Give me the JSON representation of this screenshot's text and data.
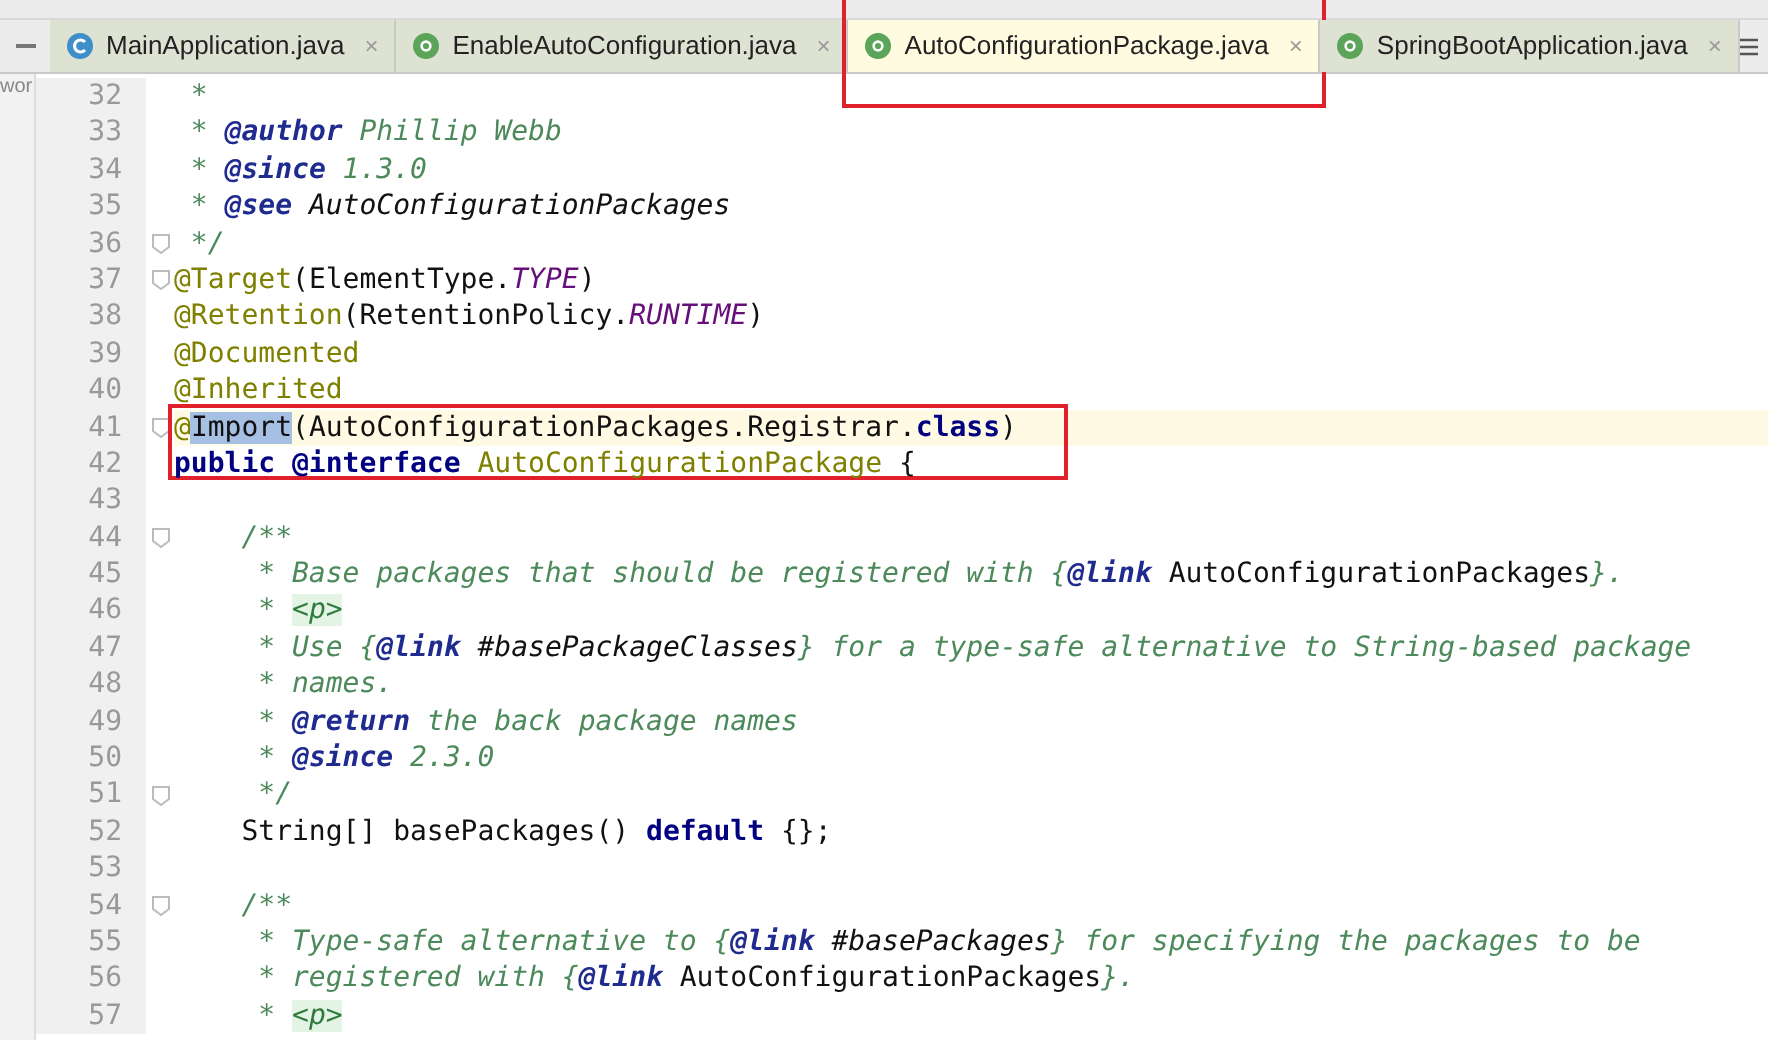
{
  "side_panel": {
    "text": "wor"
  },
  "tabs": [
    {
      "label": "MainApplication.java",
      "kind": "class",
      "close": "×",
      "selected": false,
      "marked": false
    },
    {
      "label": "EnableAutoConfiguration.java",
      "kind": "annotation",
      "close": "×",
      "selected": false,
      "marked": false
    },
    {
      "label": "AutoConfigurationPackage.java",
      "kind": "annotation",
      "close": "×",
      "selected": true,
      "marked": true
    },
    {
      "label": "SpringBootApplication.java",
      "kind": "annotation",
      "close": "×",
      "selected": false,
      "marked": false
    }
  ],
  "lines": [
    {
      "number": "32",
      "tokens": [
        {
          "text": " *",
          "kind": "comment"
        }
      ]
    },
    {
      "number": "33",
      "tokens": [
        {
          "text": " * ",
          "kind": "comment"
        },
        {
          "text": "@author",
          "kind": "doctag"
        },
        {
          "text": " Phillip Webb",
          "kind": "comment"
        }
      ]
    },
    {
      "number": "34",
      "tokens": [
        {
          "text": " * ",
          "kind": "comment"
        },
        {
          "text": "@since",
          "kind": "doctag"
        },
        {
          "text": " 1.3.0",
          "kind": "comment"
        }
      ]
    },
    {
      "number": "35",
      "tokens": [
        {
          "text": " * ",
          "kind": "comment"
        },
        {
          "text": "@see",
          "kind": "doctag"
        },
        {
          "text": " AutoConfigurationPackages",
          "kind": "ref"
        }
      ]
    },
    {
      "number": "36",
      "fold": true,
      "tokens": [
        {
          "text": " */",
          "kind": "comment"
        }
      ]
    },
    {
      "number": "37",
      "fold": true,
      "tokens": [
        {
          "text": "@Target",
          "kind": "annotation"
        },
        {
          "text": "(ElementType.",
          "kind": "plain"
        },
        {
          "text": "TYPE",
          "kind": "constant"
        },
        {
          "text": ")",
          "kind": "plain"
        }
      ]
    },
    {
      "number": "38",
      "tokens": [
        {
          "text": "@Retention",
          "kind": "annotation"
        },
        {
          "text": "(RetentionPolicy.",
          "kind": "plain"
        },
        {
          "text": "RUNTIME",
          "kind": "constant"
        },
        {
          "text": ")",
          "kind": "plain"
        }
      ]
    },
    {
      "number": "39",
      "tokens": [
        {
          "text": "@Documented",
          "kind": "annotation"
        }
      ]
    },
    {
      "number": "40",
      "tokens": [
        {
          "text": "@Inherited",
          "kind": "annotation"
        }
      ]
    },
    {
      "number": "41",
      "fold": true,
      "current": true,
      "marked": true,
      "tokens": [
        {
          "text": "@",
          "kind": "annotation"
        },
        {
          "text": "Import",
          "kind": "selected"
        },
        {
          "text": "(AutoConfigurationPackages.Registrar.",
          "kind": "plain"
        },
        {
          "text": "class",
          "kind": "keyword"
        },
        {
          "text": ")",
          "kind": "plain"
        }
      ]
    },
    {
      "number": "42",
      "tokens": [
        {
          "text": "public @interface",
          "kind": "keyword"
        },
        {
          "text": " AutoConfigurationPackage",
          "kind": "annotation"
        },
        {
          "text": " {",
          "kind": "plain"
        }
      ]
    },
    {
      "number": "43"
    },
    {
      "number": "44",
      "fold": true,
      "tokens": [
        {
          "text": "    /**",
          "kind": "comment"
        }
      ]
    },
    {
      "number": "45",
      "tokens": [
        {
          "text": "     * Base packages that should be registered with {",
          "kind": "comment"
        },
        {
          "text": "@link",
          "kind": "doctag"
        },
        {
          "text": " AutoConfigurationPackages",
          "kind": "plain"
        },
        {
          "text": "}.",
          "kind": "comment"
        }
      ]
    },
    {
      "number": "46",
      "tokens": [
        {
          "text": "     * ",
          "kind": "comment"
        },
        {
          "text": "<p>",
          "kind": "html"
        }
      ]
    },
    {
      "number": "47",
      "tokens": [
        {
          "text": "     * Use {",
          "kind": "comment"
        },
        {
          "text": "@link",
          "kind": "doctag"
        },
        {
          "text": " #basePackageClasses",
          "kind": "ref"
        },
        {
          "text": "} for a type-safe alternative to String-based package",
          "kind": "comment"
        }
      ]
    },
    {
      "number": "48",
      "tokens": [
        {
          "text": "     * names.",
          "kind": "comment"
        }
      ]
    },
    {
      "number": "49",
      "tokens": [
        {
          "text": "     * ",
          "kind": "comment"
        },
        {
          "text": "@return",
          "kind": "doctag"
        },
        {
          "text": " the back package names",
          "kind": "comment"
        }
      ]
    },
    {
      "number": "50",
      "tokens": [
        {
          "text": "     * ",
          "kind": "comment"
        },
        {
          "text": "@since",
          "kind": "doctag"
        },
        {
          "text": " 2.3.0",
          "kind": "comment"
        }
      ]
    },
    {
      "number": "51",
      "fold": true,
      "tokens": [
        {
          "text": "     */",
          "kind": "comment"
        }
      ]
    },
    {
      "number": "52",
      "tokens": [
        {
          "text": "    String[] basePackages() ",
          "kind": "plain"
        },
        {
          "text": "default",
          "kind": "keyword"
        },
        {
          "text": " {};",
          "kind": "plain"
        }
      ]
    },
    {
      "number": "53"
    },
    {
      "number": "54",
      "fold": true,
      "tokens": [
        {
          "text": "    /**",
          "kind": "comment"
        }
      ]
    },
    {
      "number": "55",
      "tokens": [
        {
          "text": "     * Type-safe alternative to {",
          "kind": "comment"
        },
        {
          "text": "@link",
          "kind": "doctag"
        },
        {
          "text": " #basePackages",
          "kind": "ref"
        },
        {
          "text": "} for specifying the packages to be",
          "kind": "comment"
        }
      ]
    },
    {
      "number": "56",
      "tokens": [
        {
          "text": "     * registered with {",
          "kind": "comment"
        },
        {
          "text": "@link",
          "kind": "doctag"
        },
        {
          "text": " AutoConfigurationPackages",
          "kind": "plain"
        },
        {
          "text": "}.",
          "kind": "comment"
        }
      ]
    },
    {
      "number": "57",
      "tokens": [
        {
          "text": "     * ",
          "kind": "comment"
        },
        {
          "text": "<p>",
          "kind": "html"
        }
      ]
    }
  ]
}
